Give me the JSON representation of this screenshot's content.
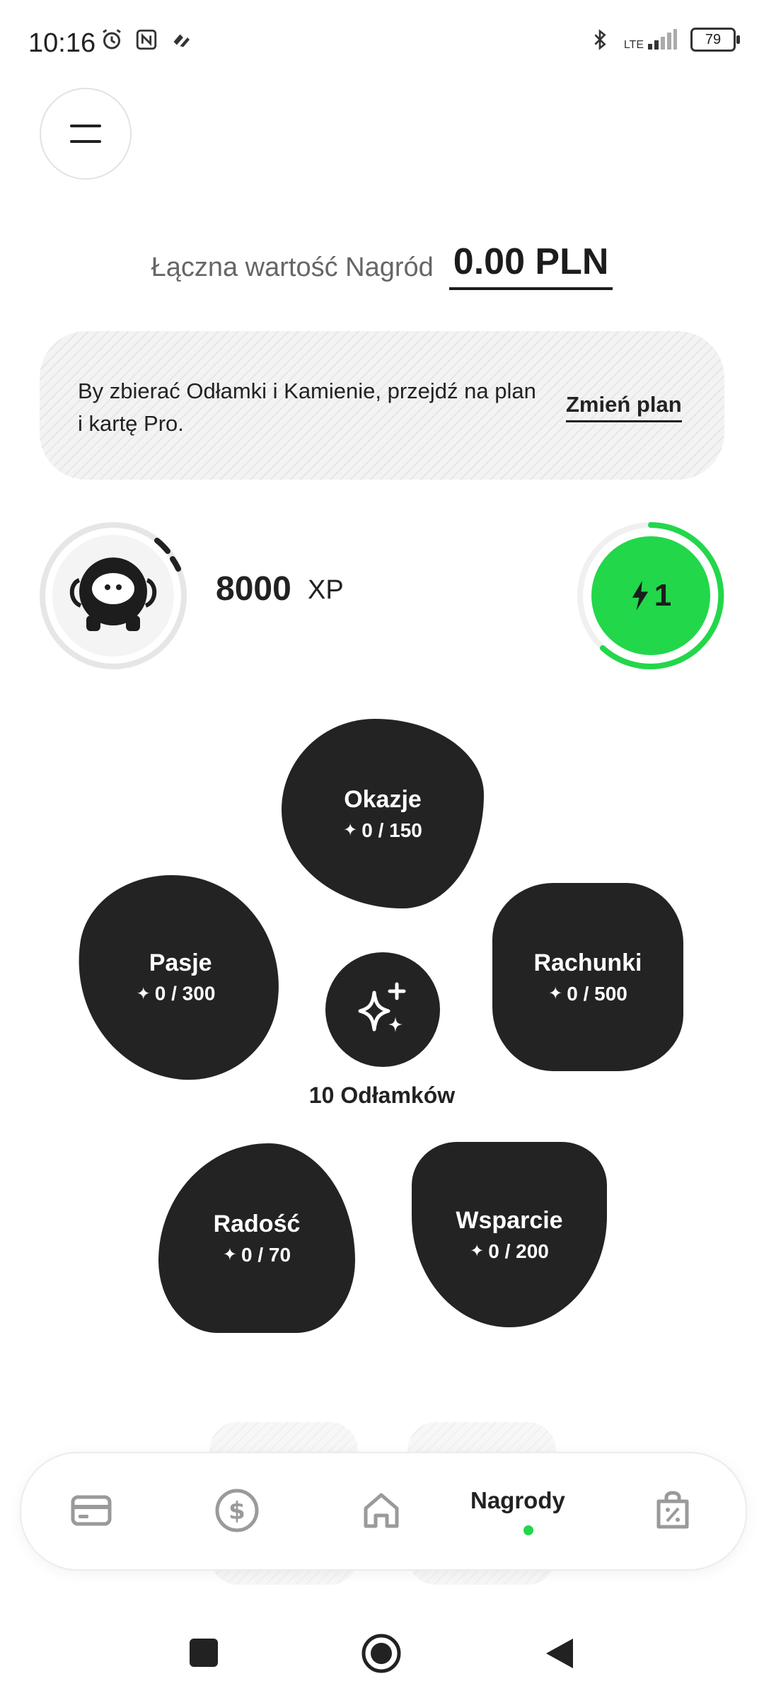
{
  "status_bar": {
    "time": "10:16",
    "network": "LTE",
    "battery": "79"
  },
  "header": {
    "menu_icon": "hamburger-icon"
  },
  "rewards": {
    "label": "Łączna wartość Nagród",
    "value": "0.00 PLN"
  },
  "banner": {
    "text": "By zbierać Odłamki i Kamienie, przejdź na plan i kartę Pro.",
    "link": "Zmień plan"
  },
  "xp": {
    "value": "8000",
    "unit": "XP",
    "energy": "1"
  },
  "stones": {
    "okazje": {
      "name": "Okazje",
      "count": "0 / 150"
    },
    "pasje": {
      "name": "Pasje",
      "count": "0 / 300"
    },
    "rachunki": {
      "name": "Rachunki",
      "count": "0 / 500"
    },
    "radosc": {
      "name": "Radość",
      "count": "0 / 70"
    },
    "wsparcie": {
      "name": "Wsparcie",
      "count": "0 / 200"
    }
  },
  "shards": {
    "label": "10 Odłamków"
  },
  "bottom_nav": {
    "items": [
      "card-icon",
      "dollar-icon",
      "home-icon",
      "Nagrody",
      "shopping-bag-icon"
    ],
    "active_label": "Nagrody"
  },
  "colors": {
    "accent_green": "#22d74a",
    "stone_dark": "#232323"
  }
}
